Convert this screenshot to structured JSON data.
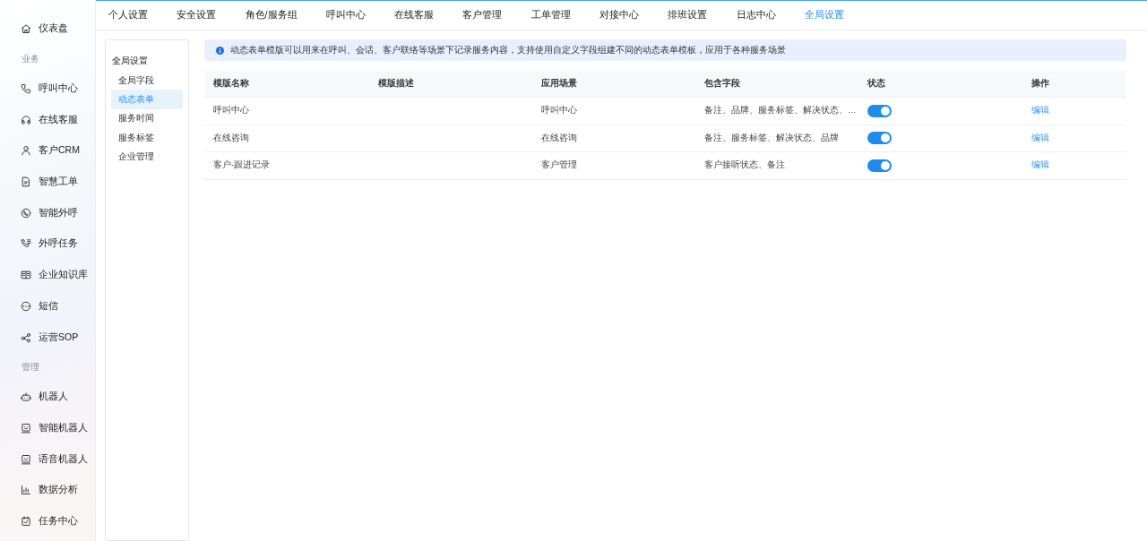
{
  "sidebar": {
    "items": [
      {
        "kind": "item",
        "label": "仪表盘",
        "selected": false
      },
      {
        "kind": "section",
        "label": "业务"
      },
      {
        "kind": "item",
        "label": "呼叫中心",
        "selected": false
      },
      {
        "kind": "item",
        "label": "在线客服",
        "selected": false
      },
      {
        "kind": "item",
        "label": "客户CRM",
        "selected": false
      },
      {
        "kind": "item",
        "label": "智慧工单",
        "selected": false
      },
      {
        "kind": "item",
        "label": "智能外呼",
        "selected": false
      },
      {
        "kind": "item",
        "label": "外呼任务",
        "selected": false
      },
      {
        "kind": "item",
        "label": "企业知识库",
        "selected": false
      },
      {
        "kind": "item",
        "label": "短信",
        "selected": false
      },
      {
        "kind": "item",
        "label": "运营SOP",
        "selected": false
      },
      {
        "kind": "section",
        "label": "管理"
      },
      {
        "kind": "item",
        "label": "机器人",
        "selected": false
      },
      {
        "kind": "item",
        "label": "智能机器人",
        "selected": false
      },
      {
        "kind": "item",
        "label": "语音机器人",
        "selected": false
      },
      {
        "kind": "item",
        "label": "数据分析",
        "selected": false
      },
      {
        "kind": "item",
        "label": "任务中心",
        "selected": false
      }
    ]
  },
  "tabs": [
    {
      "label": "个人设置",
      "selected": false
    },
    {
      "label": "安全设置",
      "selected": false
    },
    {
      "label": "角色/服务组",
      "selected": false
    },
    {
      "label": "呼叫中心",
      "selected": false
    },
    {
      "label": "在线客服",
      "selected": false
    },
    {
      "label": "客户管理",
      "selected": false
    },
    {
      "label": "工单管理",
      "selected": false
    },
    {
      "label": "对接中心",
      "selected": false
    },
    {
      "label": "排班设置",
      "selected": false
    },
    {
      "label": "日志中心",
      "selected": false
    },
    {
      "label": "全局设置",
      "selected": true
    }
  ],
  "submenu": {
    "title": "全局设置",
    "items": [
      {
        "label": "全局字段",
        "selected": false
      },
      {
        "label": "动态表单",
        "selected": true
      },
      {
        "label": "服务时间",
        "selected": false
      },
      {
        "label": "服务标签",
        "selected": false
      },
      {
        "label": "企业管理",
        "selected": false
      }
    ]
  },
  "notice": "动态表单模版可以用来在呼叫、会话、客户联络等场景下记录服务内容，支持使用自定义字段组建不同的动态表单模板，应用于各种服务场景",
  "table": {
    "columns": [
      "模版名称",
      "模版描述",
      "应用场景",
      "包含字段",
      "状态",
      "操作"
    ],
    "rows": [
      {
        "name": "呼叫中心",
        "description": "",
        "scene": "呼叫中心",
        "fields": "备注、品牌、服务标签、解决状态、…",
        "on": true,
        "action": "编辑"
      },
      {
        "name": "在线咨询",
        "description": "",
        "scene": "在线咨询",
        "fields": "备注、服务标签、解决状态、品牌",
        "on": true,
        "action": "编辑"
      },
      {
        "name": "客户-跟进记录",
        "description": "",
        "scene": "客户管理",
        "fields": "客户接听状态、备注",
        "on": true,
        "action": "编辑"
      }
    ]
  }
}
